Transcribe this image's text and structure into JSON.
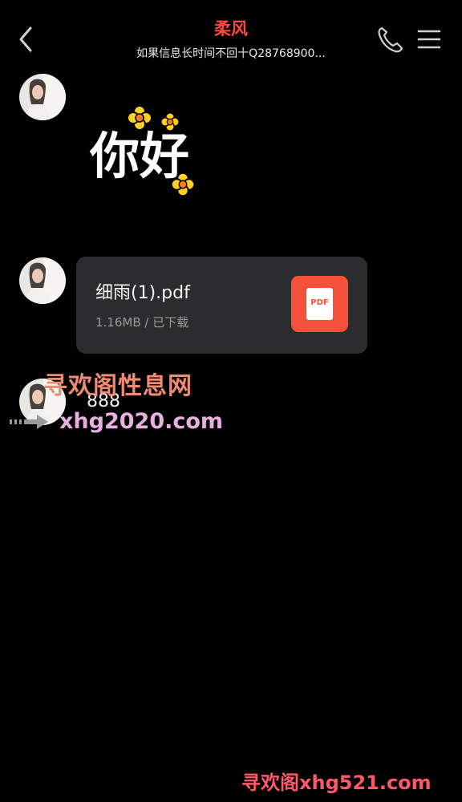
{
  "header": {
    "title": "柔风",
    "subtitle": "如果信息长时间不回十Q28768900..."
  },
  "icons": {
    "back": "chevron-left-icon",
    "phone": "phone-icon",
    "menu": "menu-icon",
    "file": "pdf-file-icon"
  },
  "messages": [
    {
      "type": "sticker",
      "text": "你好"
    },
    {
      "type": "file",
      "file_name": "细雨(1).pdf",
      "file_meta": "1.16MB / 已下载",
      "badge": "PDF"
    },
    {
      "type": "text",
      "text": "888"
    }
  ],
  "watermarks": {
    "middle_cn": "寻欢阁性息网",
    "middle_url": "xhg2020.com",
    "bottom": "寻欢阁xhg521.com"
  },
  "colors": {
    "title": "#ff4a3d",
    "background": "#000000",
    "bubble": "#2c2c2e",
    "pdf": "#f4503a"
  }
}
